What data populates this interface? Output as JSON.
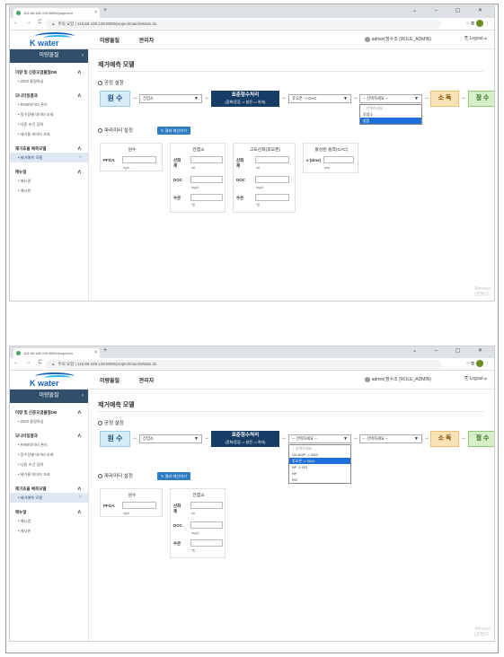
{
  "browser": {
    "tab_title": "115.68.185.139:8090/project/m",
    "url_warning": "주의 요함",
    "url": "115.68.185.139:8090/project/main/isMain.do"
  },
  "header": {
    "logo_text": "K water",
    "nav": [
      "미량물질",
      "관리자"
    ],
    "user": "admin(정수조 (ROLE_ADMIN)",
    "logout": "Logout"
  },
  "sidebar": {
    "title": "미량물질",
    "sections": [
      {
        "label": "미량 및 신종오염물질DB",
        "items": [
          "2023 물질특성"
        ]
      },
      {
        "label": "모니터링결과",
        "items": [
          "RAW데이터 관리",
          "정수장별 데이터 조회",
          "다중 조건 검색",
          "제거율 데이터 조회"
        ]
      },
      {
        "label": "제거효율 예측모델",
        "items": [
          "제거예측 모델"
        ]
      },
      {
        "label": "매뉴얼",
        "items": [
          "매뉴얼",
          "게시판"
        ]
      }
    ]
  },
  "page": {
    "title": "제거예측 모델",
    "process_section": "공정 설정",
    "param_section": "파라미터 설정",
    "calc_button": "결과 계산하기"
  },
  "process": {
    "source": "원 수",
    "pre_select": "전염소",
    "std_title": "표준정수처리",
    "std_sub": "(혼화/응집 -> 침전 -> 여과)",
    "disinfect": "소 독",
    "final": "정 수"
  },
  "screen1": {
    "adv1_select": "후오존 -> GAC",
    "adv2_select": "-- 선택하세요 --",
    "dropdown": [
      "-- 선택하세요 --",
      "후염소",
      "없음"
    ],
    "dropdown_selected": 2,
    "params": {
      "raw": {
        "header": "원수",
        "label": "PFOA",
        "unit": "ng/L"
      },
      "pre": {
        "header": "전염소",
        "rows": [
          {
            "label": "산화제",
            "unit": "ml"
          },
          {
            "label": "DOC",
            "unit": "mg/L"
          },
          {
            "label": "수온",
            "unit": "℃"
          }
        ]
      },
      "adv": {
        "header": "고도산화(후오존)",
        "rows": [
          {
            "label": "산화제",
            "unit": "ml"
          },
          {
            "label": "DOC",
            "unit": "mg/L"
          },
          {
            "label": "수온",
            "unit": "℃"
          }
        ]
      },
      "gac": {
        "header": "활성탄 흡착(GAC)",
        "label": "s (time)",
        "unit": "sec"
      }
    }
  },
  "screen2": {
    "adv1_select": "-- 선택하세요 --",
    "adv2_select": "-- 선택하세요 --",
    "dropdown": [
      "-- 선택하세요 --",
      "UV-AOP -> GAC",
      "후오존 -> GAC",
      "NF -> RO",
      "NF",
      "RO"
    ],
    "dropdown_selected": 2,
    "params": {
      "raw": {
        "header": "원수",
        "label": "PFOA",
        "unit": "ng/L"
      },
      "pre": {
        "header": "전염소",
        "rows": [
          {
            "label": "산화제",
            "unit": "ml"
          },
          {
            "label": "DOC",
            "unit": "mg/L"
          },
          {
            "label": "수온",
            "unit": "℃"
          }
        ]
      }
    }
  },
  "watermark": {
    "line1": "Window",
    "line2": "[설정]으"
  },
  "colors": {
    "sidebar_header": "#2f4f6a",
    "std_box": "#173d66",
    "source_box": "#d4edf9",
    "disinfect_box": "#fbe1b6",
    "final_box": "#d6efc9",
    "button": "#2f7ec4",
    "dropdown_highlight": "#1e6fd9"
  }
}
